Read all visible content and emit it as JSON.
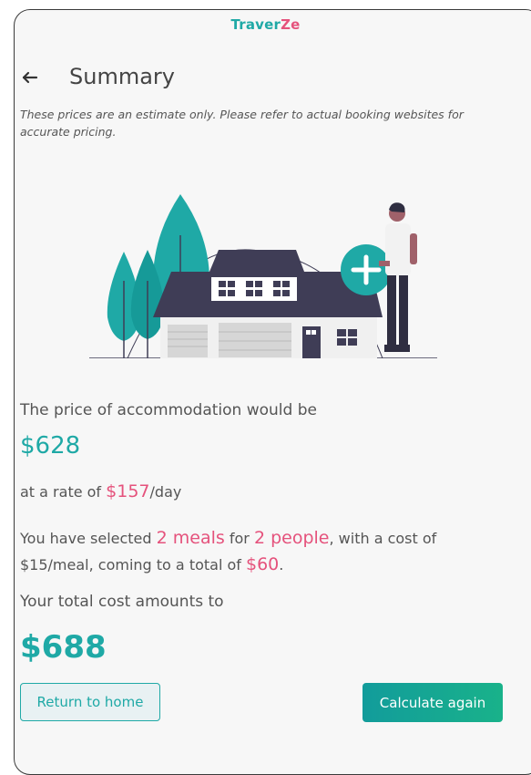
{
  "app": {
    "brand_part1": "Traver",
    "brand_part2": "Ze",
    "brand_color": "#1fa9a6",
    "brand_accent": "#e5527c"
  },
  "header": {
    "back_icon": "arrow-left-icon",
    "title": "Summary"
  },
  "disclaimer": "These prices are an estimate only. Please refer to actual booking websites for accurate pricing.",
  "illustration": {
    "icon": "house-with-person-plus-icon"
  },
  "accommodation": {
    "label": "The price of accommodation would be",
    "price": "$628",
    "rate_prefix": "at a rate of ",
    "rate_value": "$157",
    "rate_suffix": "/day"
  },
  "meals": {
    "prefix": "You have selected ",
    "meals_value": "2 meals",
    "middle": " for ",
    "people_value": "2 people",
    "after_people": ", with a cost of $15/meal, coming to a total of ",
    "total_value": "$60",
    "end": "."
  },
  "total": {
    "label": "Your total cost amounts to",
    "value": "$688"
  },
  "actions": {
    "return_label": "Return to home",
    "calculate_label": "Calculate again"
  }
}
